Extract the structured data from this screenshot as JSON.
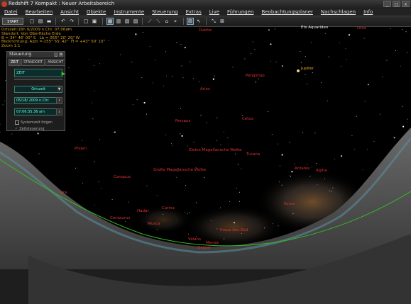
{
  "window": {
    "title": "Redshift 7 Kompakt : Neuer Arbeitsbereich",
    "buttons": {
      "minimize": "_",
      "maximize": "□",
      "close": "×"
    }
  },
  "menu": [
    "Datei",
    "Bearbeiten",
    "Ansicht",
    "Objekte",
    "Instrumente",
    "Steuerung",
    "Extras",
    "Live",
    "Führungen",
    "Beobachtungsplaner",
    "Nachschlagen",
    "Info"
  ],
  "toolbar": {
    "start_label": "START"
  },
  "info": {
    "line1": "Ortszeit:16h 9/2009 n.Chr. 07:06am",
    "line2": "Standort: Von Oberfläche Erde",
    "line3": "B = 34° 46' 00\" S   Lä = 055° 20' 20\" W",
    "line4": "Blickrichtung: Azm = 155° 55' 42\"  H = +43° 50' 10\"",
    "line5": "Zoom 1:1"
  },
  "panel": {
    "title": "Steuerung",
    "tabs": [
      "ZEIT",
      "STANDORT",
      "ANSICHT"
    ],
    "zeit_value": "ZEIT",
    "timezone": "Ortszeit",
    "date": "05/18/ 2009 n.Chr.",
    "time": "07:06:35.36 am",
    "check_systemzeit": "Systemzeit folgen",
    "check_zeitsteuerung": "Zeitsteuerung"
  },
  "labels": {
    "dubhe": "Dubhe",
    "ets": "Ets Aquariden",
    "ursa": "Ursa",
    "jupiter": "Jupiter",
    "pegasus": "Pengshop",
    "aries": "Aries",
    "cetus": "Cetus",
    "perseus": "Perseus",
    "smc": "Kleine Magellansche Wolke",
    "lmc": "Große Magellansche Wolke",
    "tucana": "Tucana",
    "canopus": "Canopus",
    "phoenix": "Phoen",
    "lyra": "Lyra",
    "antares": "Antares",
    "acrux": "Acrux",
    "alpha": "Alpha",
    "carina": "Carina",
    "hadar": "Hadar",
    "centaurus": "Centaurus",
    "crux": "Kreuz des Süd",
    "musca": "Musca",
    "volans": "Volans",
    "mensa": "Mensa",
    "octans": "Oktant"
  },
  "colors": {
    "label": "#e03030",
    "horizon": "#33bb22",
    "panel_accent": "#3c7d6e"
  }
}
